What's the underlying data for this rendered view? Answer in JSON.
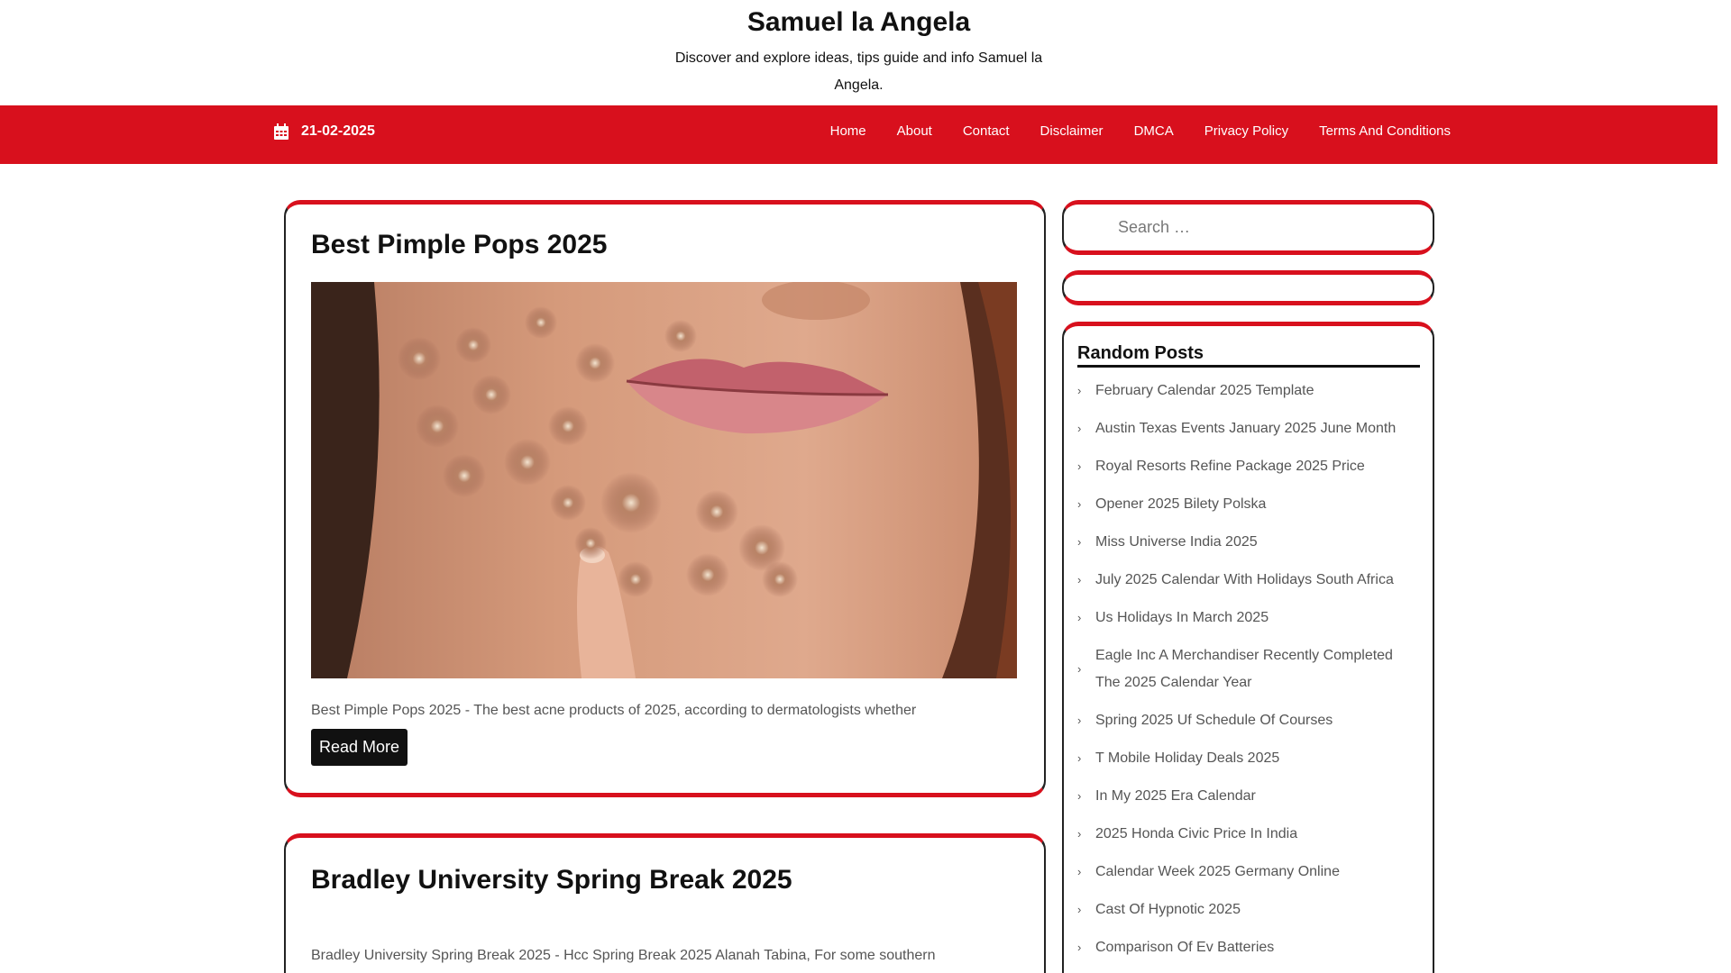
{
  "site": {
    "title": "Samuel la Angela",
    "description": "Discover and explore ideas, tips guide and info Samuel la Angela."
  },
  "nav": {
    "date": "21-02-2025",
    "items": [
      "Home",
      "About",
      "Contact",
      "Disclaimer",
      "DMCA",
      "Privacy Policy",
      "Terms And Conditions"
    ]
  },
  "posts": [
    {
      "title": "Best Pimple Pops 2025",
      "excerpt": "Best Pimple Pops 2025 - The best acne products of 2025, according to dermatologists whether",
      "read_more": "Read More"
    },
    {
      "title": "Bradley University Spring Break 2025",
      "excerpt": "Bradley University Spring Break 2025 - Hcc Spring Break 2025 Alanah Tabina, For some southern"
    }
  ],
  "search": {
    "placeholder": "Search …"
  },
  "random_posts": {
    "title": "Random Posts",
    "items": [
      "February Calendar 2025 Template",
      "Austin Texas Events January 2025 June Month",
      "Royal Resorts Refine Package 2025 Price",
      "Opener 2025 Bilety Polska",
      "Miss Universe India 2025",
      "July 2025 Calendar With Holidays South Africa",
      "Us Holidays In March 2025",
      "Eagle Inc A Merchandiser Recently Completed The 2025 Calendar Year",
      "Spring 2025 Uf Schedule Of Courses",
      "T Mobile Holiday Deals 2025",
      "In My 2025 Era Calendar",
      "2025 Honda Civic Price In India",
      "Calendar Week 2025 Germany Online",
      "Cast Of Hypnotic 2025",
      "Comparison Of Ev Batteries"
    ]
  },
  "colors": {
    "accent": "#d8101d",
    "button": "#111111"
  }
}
